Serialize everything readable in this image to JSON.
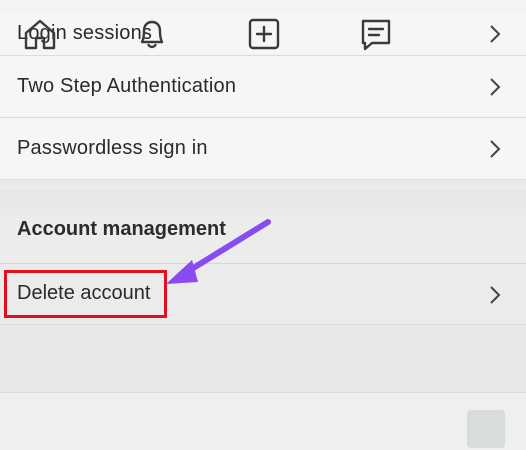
{
  "settings": {
    "items": [
      {
        "label": "Login sessions"
      },
      {
        "label": "Two Step Authentication"
      },
      {
        "label": "Passwordless sign in"
      }
    ],
    "section_title": "Account management",
    "delete_label": "Delete account"
  },
  "annotation": {
    "highlight_color": "#e0101e",
    "arrow_color": "#8a4cf0"
  },
  "bottom_nav": {
    "icons": [
      "home-icon",
      "bell-icon",
      "plus-square-icon",
      "chat-icon",
      "avatar"
    ]
  }
}
